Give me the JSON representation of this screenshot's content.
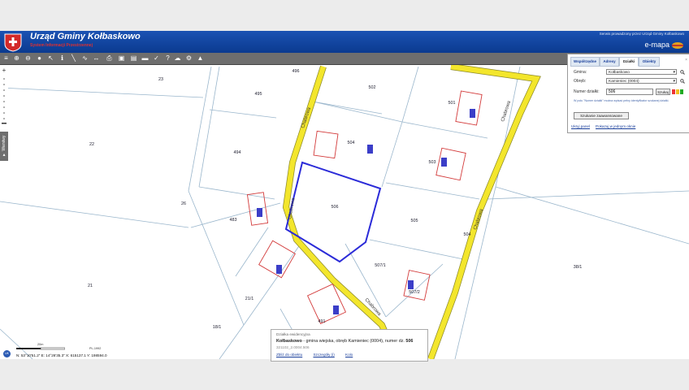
{
  "header": {
    "title": "Urząd Gminy Kołbaskowo",
    "subtitle": "System Informacji Przestrzennej",
    "service_note": "Serwis prowadzony przez Urząd Gminy Kołbaskowo",
    "brand": "e-mapa"
  },
  "toolbar": {
    "icons": [
      "layers-icon",
      "zoom-in-icon",
      "zoom-out-icon",
      "full-extent-icon",
      "select-icon",
      "info-icon",
      "measure-line-icon",
      "measure-area-icon",
      "pan-icon",
      "print-icon",
      "export-icon",
      "bookmark-icon",
      "car-icon",
      "help-icon",
      "question-icon",
      "cloud-icon",
      "settings-icon",
      "gps-icon"
    ]
  },
  "left": {
    "layers_tab": "▼ Warstwy"
  },
  "panel": {
    "tabs": [
      "Współrzędne",
      "Adresy",
      "Działki",
      "Obiekty"
    ],
    "active_tab": "Działki",
    "gmina_label": "Gmina:",
    "gmina_value": "Kołbaskowo",
    "obreb_label": "Obręb:",
    "obreb_value": "Kamieniec (0004)",
    "numer_label": "Numer działki:",
    "numer_value": "506",
    "search_button": "Szukaj",
    "hint": "W polu \"Numer działki\" można wpisać pełny identyfikator szukanej działki.",
    "advanced_button": "Szukanie zaawansowane",
    "link_hide": "Ukryj panel",
    "link_all": "Pokazuj w jednym oknie",
    "close": "×"
  },
  "map": {
    "parcels": [
      "23",
      "496",
      "495",
      "502",
      "501",
      "22",
      "494",
      "504",
      "503",
      "506",
      "26",
      "483",
      "505",
      "507/1",
      "38/1",
      "21",
      "21/1",
      "507/2",
      "491",
      "18/1",
      "504"
    ],
    "selected_parcel": "506",
    "road_labels": [
      "Chabrowa",
      "Chabrowa",
      "Chabrowa",
      "Chabrowa",
      "Chabrowa"
    ],
    "selection_color": "#2b2bd8",
    "road_color": "#f3e62c",
    "building_color": "#d33a3a"
  },
  "popup": {
    "heading": "Działka ewidencyjna",
    "main_prefix": "Kołbaskowo",
    "main_mid": " - gmina wiejska, obręb Kamieniec (0004), numer dz. ",
    "main_num": "506",
    "identifier": "321102_2.0004.506",
    "link_zoom": "Zbliż do obiektu",
    "link_details": "Szczegóły (i)",
    "link_share": "Kolo"
  },
  "status": {
    "scale_label": "20m",
    "crs": "PL-1992",
    "coords": "N: 53°10'51.2\"  E: 14°26'35.3\"  X: 615137.1  Y: 198594.0",
    "badge": "UK"
  }
}
